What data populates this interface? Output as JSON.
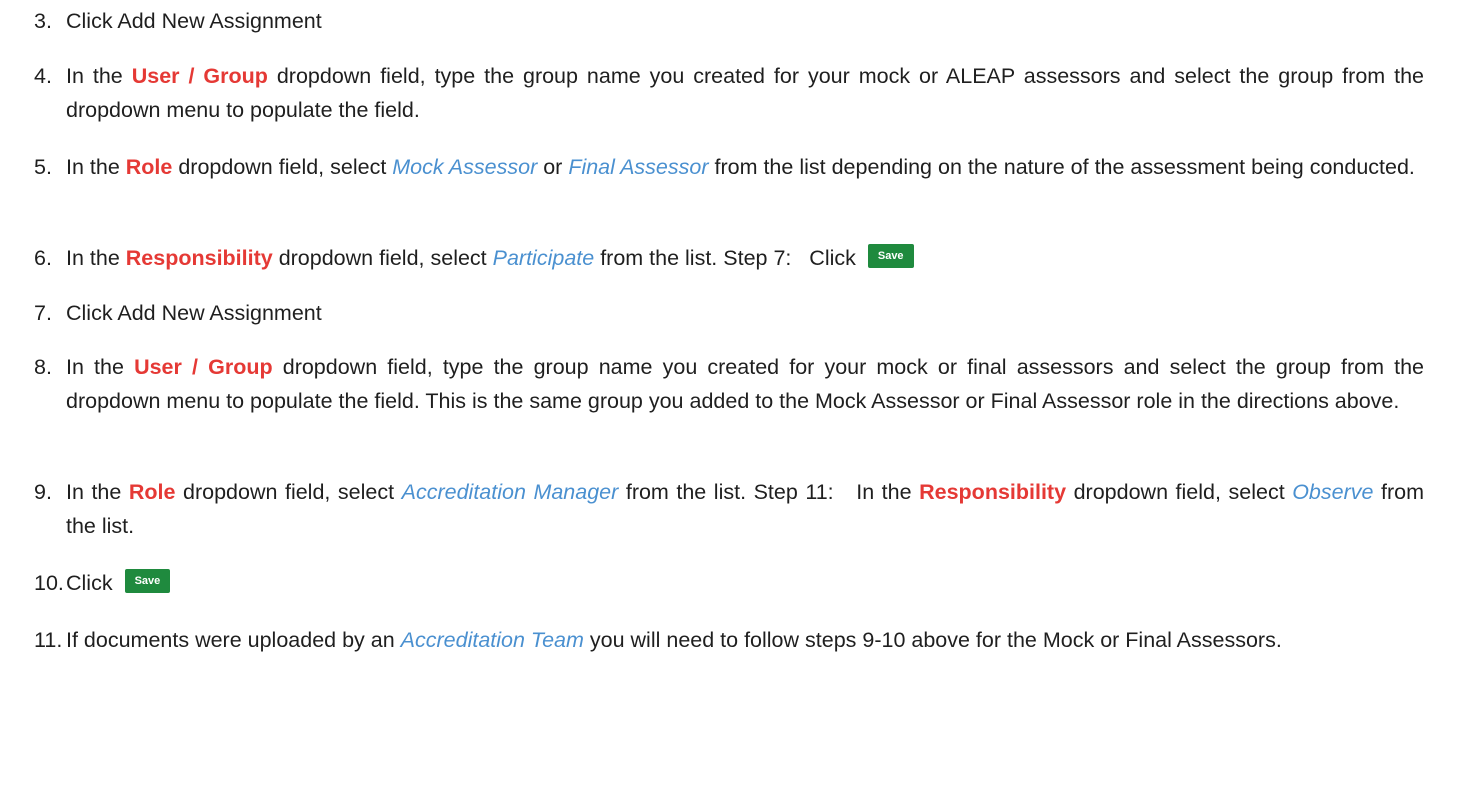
{
  "steps": [
    {
      "n": "3.",
      "text": "Click Add New Assignment"
    },
    {
      "n": "4.",
      "pre": "In the ",
      "hl": "User / Group",
      "post": " dropdown field, type the group name you created for your mock or ALEAP assessors and select the group from the dropdown menu to populate the field."
    },
    {
      "n": "5.",
      "pre": "In the ",
      "hl": "Role",
      "mid": " dropdown field, select ",
      "em1": "Mock Assessor",
      "or": " or ",
      "em2": "Final Assessor",
      "post": " from the list depending on the nature of the assessment being conducted."
    },
    {
      "n": "6.",
      "pre": "In the ",
      "hl": "Responsibility",
      "mid": " dropdown field, select ",
      "em1": "Participate",
      "post": " from the list. Step 7:   Click "
    },
    {
      "n": "7.",
      "text": "Click Add New Assignment"
    },
    {
      "n": "8.",
      "pre": "In the ",
      "hl": "User / Group",
      "post": " dropdown field, type the group name you created for your mock or final assessors and select the group from the dropdown menu to populate the field. This is the same group you added to the Mock Assessor or Final Assessor role in the directions above."
    },
    {
      "n": "9.",
      "pre": "In the ",
      "hl": "Role",
      "mid": " dropdown field, select ",
      "em1": "Accreditation Manager",
      "mid2": " from the list. Step 11:   In the ",
      "hl2": "Responsibility",
      "post": " dropdown field, select ",
      "em2": "Observe",
      "post2": " from the list."
    },
    {
      "n": "10.",
      "text": "Click "
    },
    {
      "n": "11.",
      "pre": "If documents were uploaded by an ",
      "em1": "Accreditation Team",
      "post": " you will need to follow steps 9-10 above for the Mock or Final Assessors."
    }
  ],
  "buttons": {
    "save_label": "Save"
  },
  "colors": {
    "highlight": "#e53935",
    "emphasis": "#4a90d0",
    "save_button": "#1f8a3e"
  }
}
